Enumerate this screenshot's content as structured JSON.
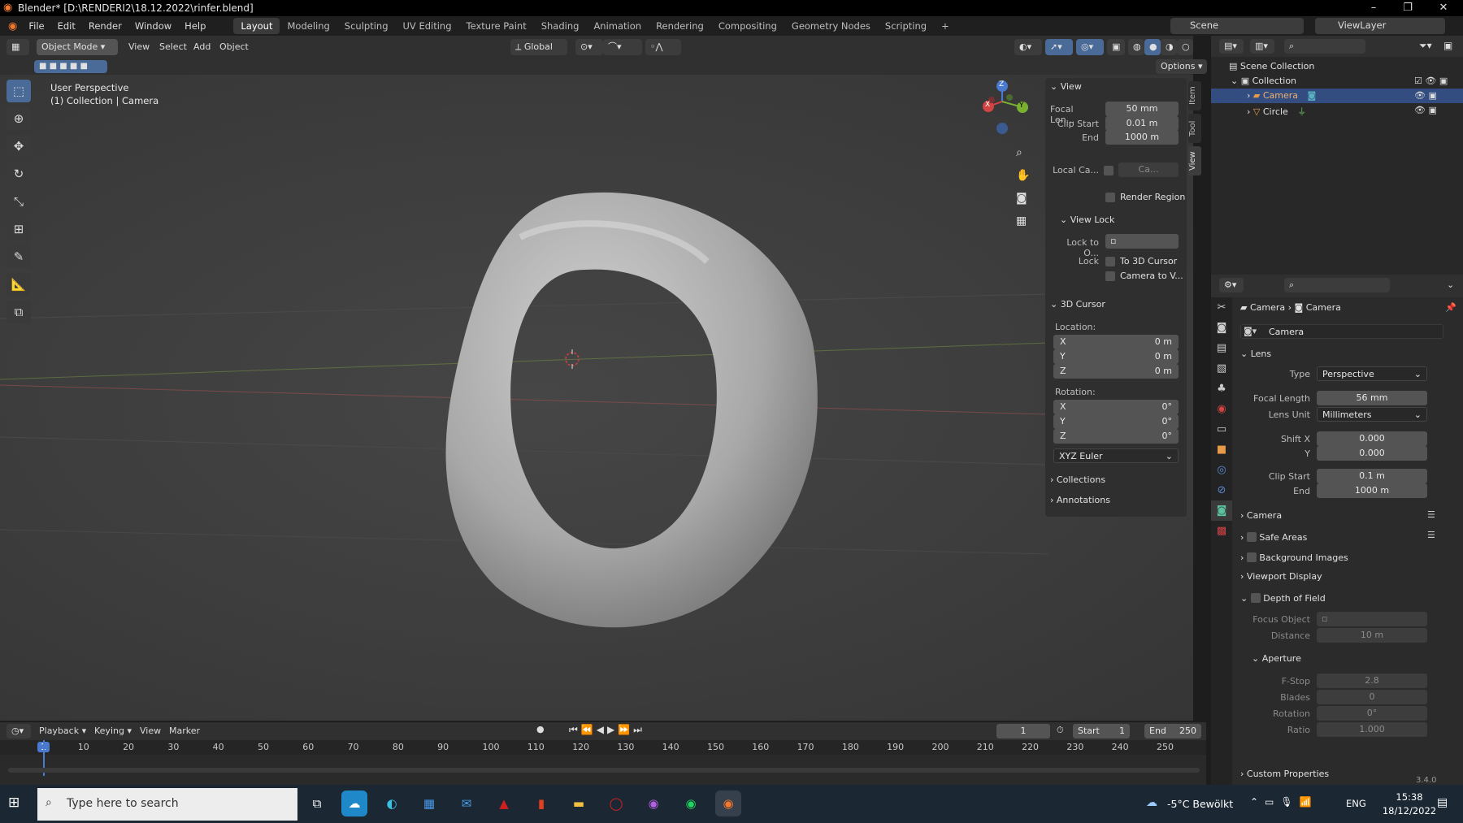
{
  "window": {
    "title": "Blender* [D:\\RENDERI2\\18.12.2022\\rinfer.blend]",
    "min": "–",
    "max": "❐",
    "close": "✕"
  },
  "menu": {
    "items": [
      "File",
      "Edit",
      "Render",
      "Window",
      "Help"
    ],
    "workspaces": [
      "Layout",
      "Modeling",
      "Sculpting",
      "UV Editing",
      "Texture Paint",
      "Shading",
      "Animation",
      "Rendering",
      "Compositing",
      "Geometry Nodes",
      "Scripting"
    ],
    "add_tab": "+",
    "scene": "Scene",
    "viewlayer": "ViewLayer"
  },
  "header": {
    "mode": "Object Mode",
    "view": "View",
    "select": "Select",
    "add": "Add",
    "object": "Object",
    "transform": "Global",
    "options": "Options"
  },
  "viewport": {
    "perspective": "User Perspective",
    "collection": "(1) Collection | Camera",
    "gizmo": {
      "x": "X",
      "y": "Y",
      "z": "Z"
    }
  },
  "npanel": {
    "tabs": [
      "Item",
      "Tool",
      "View"
    ],
    "view_title": "View",
    "focal_label": "Focal Len...",
    "focal_value": "50 mm",
    "clip_start_label": "Clip Start",
    "clip_start_value": "0.01 m",
    "end_label": "End",
    "end_value": "1000 m",
    "local_camera_label": "Local Ca...",
    "local_camera_value": "Ca...",
    "render_region": "Render Region",
    "view_lock_title": "View Lock",
    "lock_to_object": "Lock to O...",
    "lock_label": "Lock",
    "to_3d_cursor": "To 3D Cursor",
    "camera_to_view": "Camera to V...",
    "cursor_title": "3D Cursor",
    "location_label": "Location:",
    "loc": [
      {
        "axis": "X",
        "value": "0 m"
      },
      {
        "axis": "Y",
        "value": "0 m"
      },
      {
        "axis": "Z",
        "value": "0 m"
      }
    ],
    "rotation_label": "Rotation:",
    "rot": [
      {
        "axis": "X",
        "value": "0°"
      },
      {
        "axis": "Y",
        "value": "0°"
      },
      {
        "axis": "Z",
        "value": "0°"
      }
    ],
    "rotation_mode": "XYZ Euler",
    "collections": "Collections",
    "annotations": "Annotations"
  },
  "outliner": {
    "scene_collection": "Scene Collection",
    "collection": "Collection",
    "items": [
      "Camera",
      "Circle"
    ]
  },
  "properties": {
    "breadcrumb_a": "Camera",
    "breadcrumb_b": "Camera",
    "datablock": "Camera",
    "lens_title": "Lens",
    "type_label": "Type",
    "type_value": "Perspective",
    "focal_label": "Focal Length",
    "focal_value": "56 mm",
    "unit_label": "Lens Unit",
    "unit_value": "Millimeters",
    "shiftx_label": "Shift X",
    "shiftx_value": "0.000",
    "shifty_label": "Y",
    "shifty_value": "0.000",
    "clipstart_label": "Clip Start",
    "clipstart_value": "0.1 m",
    "end_label": "End",
    "end_value": "1000 m",
    "camera": "Camera",
    "safe_areas": "Safe Areas",
    "background_images": "Background Images",
    "viewport_display": "Viewport Display",
    "dof": "Depth of Field",
    "focus_object": "Focus Object",
    "distance_label": "Distance",
    "distance_value": "10 m",
    "aperture": "Aperture",
    "fstop_label": "F-Stop",
    "fstop_value": "2.8",
    "blades_label": "Blades",
    "blades_value": "0",
    "rotation_label": "Rotation",
    "rotation_value": "0°",
    "ratio_label": "Ratio",
    "ratio_value": "1.000",
    "custom_props": "Custom Properties"
  },
  "timeline": {
    "playback": "Playback",
    "keying": "Keying",
    "view": "View",
    "marker": "Marker",
    "current": "1",
    "start_label": "Start",
    "start_value": "1",
    "end_label": "End",
    "end_value": "250",
    "ticks": [
      "1",
      "10",
      "20",
      "30",
      "40",
      "50",
      "60",
      "70",
      "80",
      "90",
      "100",
      "110",
      "120",
      "130",
      "140",
      "150",
      "160",
      "170",
      "180",
      "190",
      "200",
      "210",
      "220",
      "230",
      "240",
      "250"
    ]
  },
  "status": {
    "version": "3.4.0"
  },
  "taskbar": {
    "search_placeholder": "Type here to search",
    "weather": "-5°C  Bewölkt",
    "lang": "ENG",
    "time": "15:38",
    "date": "18/12/2022"
  }
}
